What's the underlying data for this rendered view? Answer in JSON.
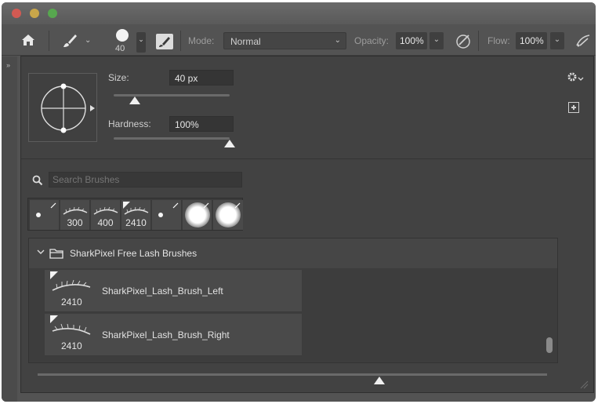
{
  "options_bar": {
    "brush_size": "40",
    "mode_label": "Mode:",
    "mode_value": "Normal",
    "opacity_label": "Opacity:",
    "opacity_value": "100%",
    "flow_label": "Flow:",
    "flow_value": "100%"
  },
  "brush_panel": {
    "size_label": "Size:",
    "size_value": "40 px",
    "size_slider_fraction": 0.2,
    "hardness_label": "Hardness:",
    "hardness_value": "100%",
    "hardness_slider_fraction": 1.0,
    "search_placeholder": "Search Brushes",
    "recent_brushes": [
      "",
      "300",
      "400",
      "2410",
      "",
      "",
      ""
    ],
    "folder_name": "SharkPixel Free Lash Brushes",
    "brushes": [
      {
        "name": "SharkPixel_Lash_Brush_Left",
        "size": "2410"
      },
      {
        "name": "SharkPixel_Lash_Brush_Right",
        "size": "2410"
      }
    ],
    "preview_zoom_fraction": 0.66
  },
  "colors": {
    "panel_bg": "#424242",
    "toolbar_bg": "#535353",
    "text": "#d6d6d6"
  },
  "icons": {
    "home": "home-icon",
    "brush": "brush-icon",
    "settings": "brush-settings-icon",
    "pressure_opacity": "pressure-opacity-icon",
    "airbrush": "airbrush-icon",
    "gear": "gear-icon",
    "new_preset": "new-preset-icon",
    "search": "search-icon",
    "folder": "folder-icon"
  }
}
